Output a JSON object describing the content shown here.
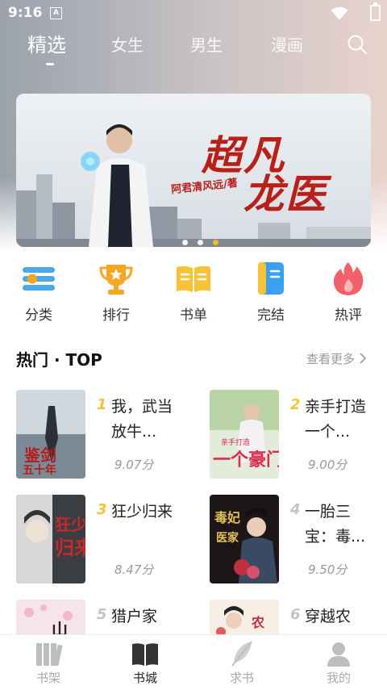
{
  "status": {
    "time": "9:16",
    "notification_icon": "A"
  },
  "tabs": {
    "items": [
      {
        "label": "精选"
      },
      {
        "label": "女生"
      },
      {
        "label": "男生"
      },
      {
        "label": "漫画"
      }
    ],
    "active": "精选"
  },
  "banner": {
    "title_line1": "超凡",
    "title_line2": "龙医",
    "author": "阿君清风远/著",
    "active_dot": 3,
    "dot_count": 3
  },
  "categories": [
    {
      "label": "分类",
      "icon": "list-icon",
      "color": "#4aa8e8"
    },
    {
      "label": "排行",
      "icon": "trophy-icon",
      "color": "#f5a623"
    },
    {
      "label": "书单",
      "icon": "book-open-icon",
      "color": "#f5c338"
    },
    {
      "label": "完结",
      "icon": "notebook-icon",
      "color": "#3aa0f0"
    },
    {
      "label": "热评",
      "icon": "flame-icon",
      "color": "#f2606a"
    }
  ],
  "section": {
    "title": "热门 · TOP",
    "more": "查看更多"
  },
  "books": [
    {
      "rank": "1",
      "title": "我，武当放牛...",
      "score": "9.07分"
    },
    {
      "rank": "2",
      "title": "亲手打造一个...",
      "score": "9.00分"
    },
    {
      "rank": "3",
      "title": "狂少归来",
      "score": "8.47分"
    },
    {
      "rank": "4",
      "title": "一胎三宝：毒...",
      "score": "9.50分"
    },
    {
      "rank": "5",
      "title": "猎户家",
      "score": ""
    },
    {
      "rank": "6",
      "title": "穿越农",
      "score": ""
    }
  ],
  "nav": [
    {
      "label": "书架",
      "icon": "bookshelf-icon"
    },
    {
      "label": "书城",
      "icon": "bookstore-icon"
    },
    {
      "label": "求书",
      "icon": "feather-icon"
    },
    {
      "label": "我的",
      "icon": "user-icon"
    }
  ],
  "nav_active": "书城"
}
